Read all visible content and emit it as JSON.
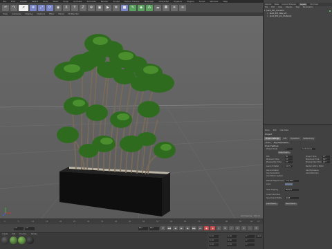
{
  "app": {
    "menu": [
      "File",
      "Edit",
      "Create",
      "Select",
      "Tools",
      "Mesh",
      "Snap",
      "Animate",
      "Simulate",
      "Render",
      "Sculpt",
      "Motion Tracker",
      "MoGraph",
      "Character",
      "Pipeline",
      "Plugins",
      "Script",
      "Window",
      "Help"
    ]
  },
  "toolbar": {
    "icons": [
      "undo-icon",
      "redo-icon",
      "live-select-icon",
      "move-icon",
      "scale-icon",
      "rotate-icon",
      "recent-tool-icon",
      "x-axis-icon",
      "y-axis-icon",
      "z-axis-icon",
      "coordinate-system-icon",
      "render-view-icon",
      "render-to-picture-viewer-icon",
      "edit-render-settings-icon",
      "cube-icon",
      "pen-icon",
      "subdivision-icon",
      "array-icon",
      "environment-icon",
      "camera-icon",
      "light-icon",
      "deformer-icon"
    ]
  },
  "viewport": {
    "menu": [
      "View",
      "Cameras",
      "Display",
      "Options",
      "Filter",
      "Panel",
      "ProRender"
    ],
    "info": "Grid Spacing : 100 cm"
  },
  "timeline": {
    "ticks": [
      "0",
      "5",
      "10",
      "15",
      "20",
      "25",
      "30",
      "35",
      "40",
      "45",
      "50",
      "55",
      "60",
      "65",
      "70",
      "75",
      "80",
      "85",
      "90"
    ],
    "end_label": "0 F"
  },
  "transport": {
    "start_field": "0 F",
    "current_field": "0 F",
    "end_field": "90 F",
    "max_field": "90 F"
  },
  "materials": {
    "menu": [
      "Create",
      "Edit",
      "Function",
      "Texture"
    ],
    "swatches": [
      "#2a2a2a",
      "#3f6e2a",
      "#4e7d35",
      "#1e1e1e"
    ]
  },
  "coordinates": {
    "position": [
      "X",
      "Y",
      "Z"
    ],
    "size": [
      "X",
      "Y",
      "Z"
    ],
    "rotation": [
      "H",
      "P",
      "B"
    ],
    "values": [
      "0 cm",
      "0 cm",
      "0 cm",
      "0 cm",
      "0 cm",
      "0 cm",
      "0 °",
      "0 °",
      "0 °"
    ],
    "mode": "Object (Rel)",
    "size_mode": "Size",
    "apply": "Apply"
  },
  "object_manager": {
    "tabs": [
      "Objects",
      "Takes",
      "Content Browser",
      "Layers",
      "Structure"
    ],
    "active_tab": "Takes",
    "menu": [
      "File",
      "Edit",
      "View",
      "Objects",
      "Tags",
      "Bookmarks"
    ],
    "objects": [
      {
        "name": "plant_001_dracaena",
        "depth": 0
      },
      {
        "name": "plant_001_fake_soil",
        "depth": 1
      },
      {
        "name": "plant_001_pot_(material)",
        "depth": 1
      }
    ]
  },
  "attributes": {
    "title": "Mode",
    "menu": [
      "Mode",
      "Edit",
      "User Data"
    ],
    "name": "Project",
    "tabs": [
      "Project Settings",
      "Info",
      "Dynamics",
      "Referencing",
      "To Do",
      "Key Interpolation"
    ],
    "active_tab": "Project Settings",
    "section": "Project Settings",
    "params": [
      {
        "label": "Project Scale",
        "value": "1",
        "unit": "Centimeters"
      },
      {
        "label": "Scale Project...",
        "button": true
      },
      {
        "label": "FPS",
        "value": "30"
      },
      {
        "label": "Project Time",
        "value": "0 F"
      },
      {
        "label": "Minimum Time",
        "value": "0 F"
      },
      {
        "label": "Maximum Time",
        "value": "90 F"
      },
      {
        "label": "Preview Min Time",
        "value": "0 F"
      },
      {
        "label": "Preview Max Time",
        "value": "90 F"
      },
      {
        "label": "Level of Detail",
        "value": "100 %"
      },
      {
        "label": "Render LOD in Editor",
        "value": ""
      },
      {
        "label": "Use Animation",
        "value": ""
      },
      {
        "label": "Use Expression",
        "value": ""
      },
      {
        "label": "Use Generators",
        "value": ""
      },
      {
        "label": "Use Deformers",
        "value": ""
      },
      {
        "label": "Use Motion System",
        "value": ""
      },
      {
        "label": "Default Object Color",
        "value": "Gray Blue"
      },
      {
        "label": "Color",
        "value": ""
      },
      {
        "label": "View Clipping",
        "value": "Medium"
      },
      {
        "label": "Linear Workflow",
        "value": ""
      },
      {
        "label": "Input Color Profile",
        "value": "sRGB"
      },
      {
        "label": "Load Preset...",
        "button": true
      },
      {
        "label": "Save Preset...",
        "button": true
      }
    ]
  }
}
